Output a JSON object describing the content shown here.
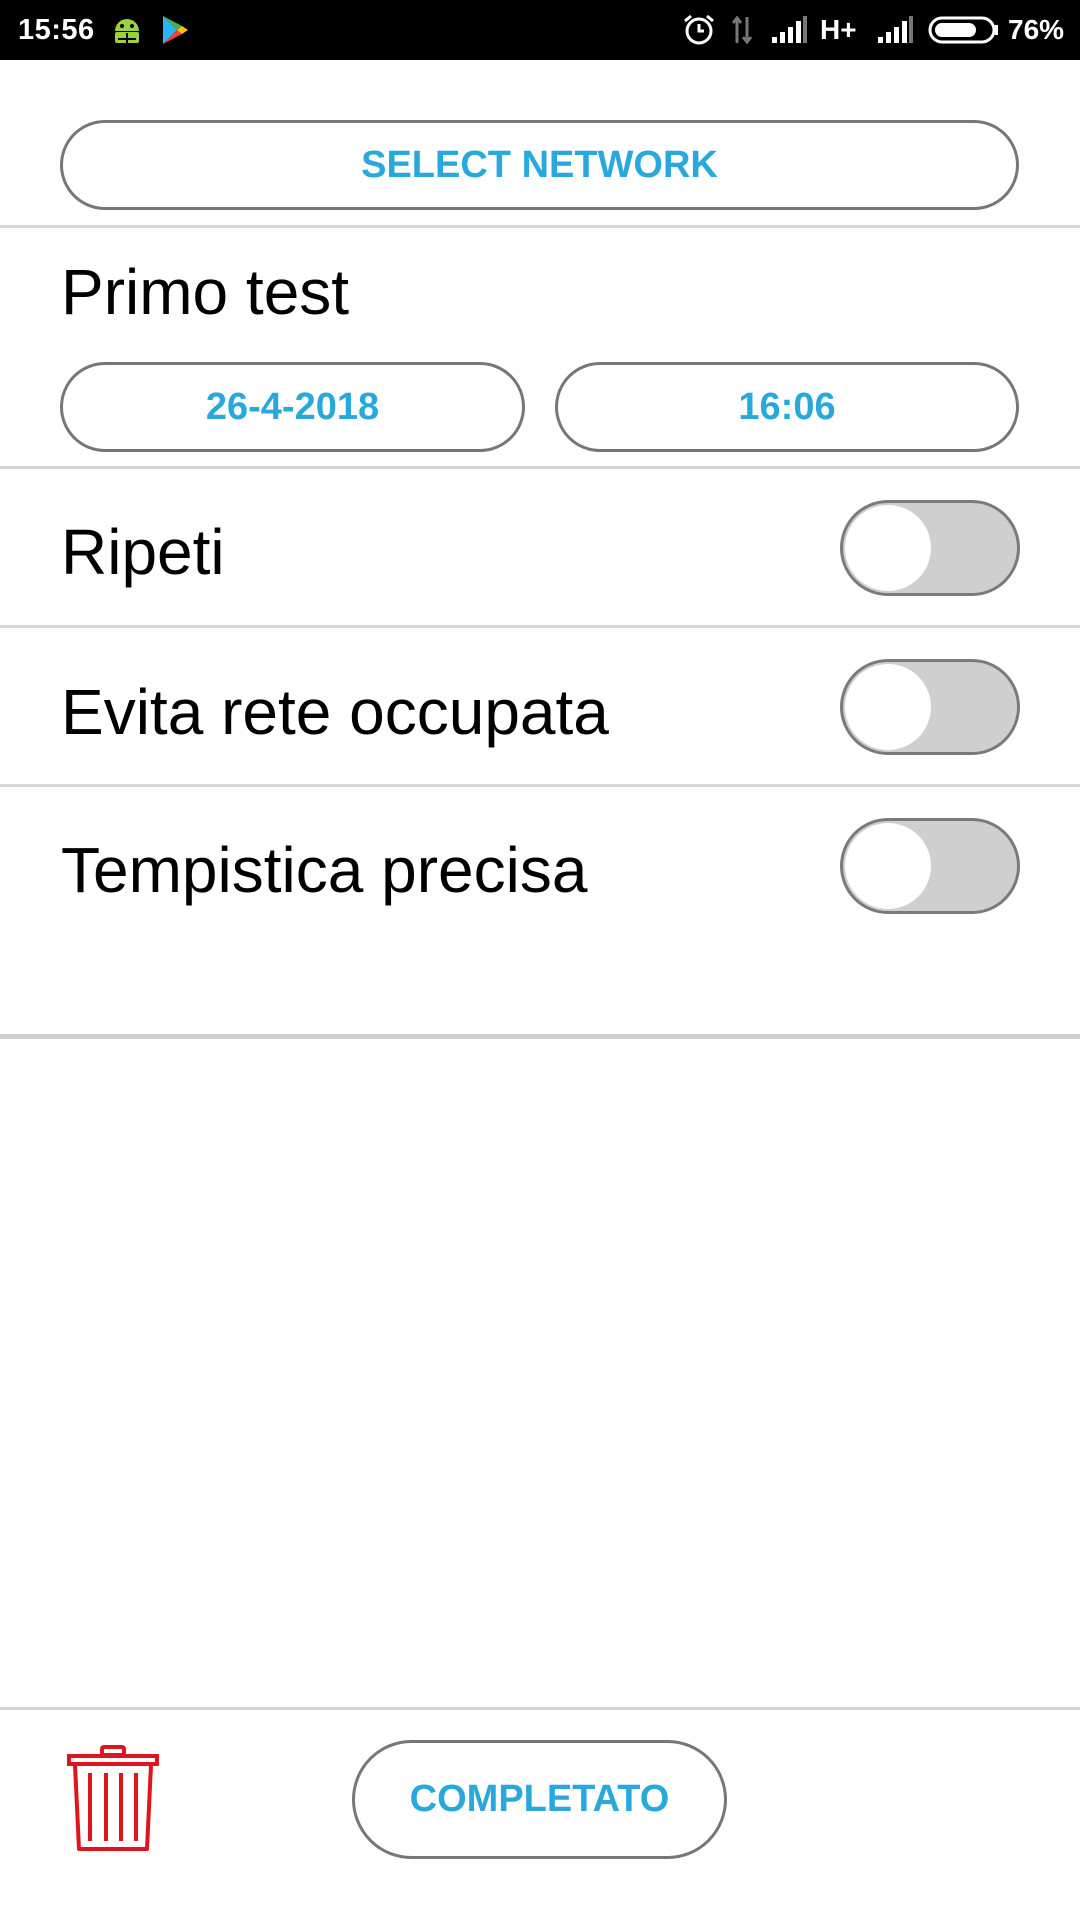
{
  "status_bar": {
    "time": "15:56",
    "network_type": "H+",
    "battery_percent": "76%",
    "battery_level": 0.76,
    "icons": [
      "android-debug-icon",
      "play-store-icon",
      "alarm-icon",
      "data-arrows-icon",
      "signal-icon",
      "battery-icon"
    ]
  },
  "select_network": {
    "label": "SELECT NETWORK"
  },
  "test": {
    "name": "Primo test",
    "date": "26-4-2018",
    "time": "16:06"
  },
  "options": [
    {
      "label": "Ripeti",
      "enabled": false
    },
    {
      "label": "Evita rete occupata",
      "enabled": false
    },
    {
      "label": "Tempistica precisa",
      "enabled": false
    }
  ],
  "footer": {
    "complete_label": "COMPLETATO",
    "delete_icon": "trash-icon"
  },
  "colors": {
    "accent": "#29a8dc",
    "delete": "#e0141e",
    "toggle_off_track": "#cfcfcf",
    "status_bar": "#000000"
  }
}
